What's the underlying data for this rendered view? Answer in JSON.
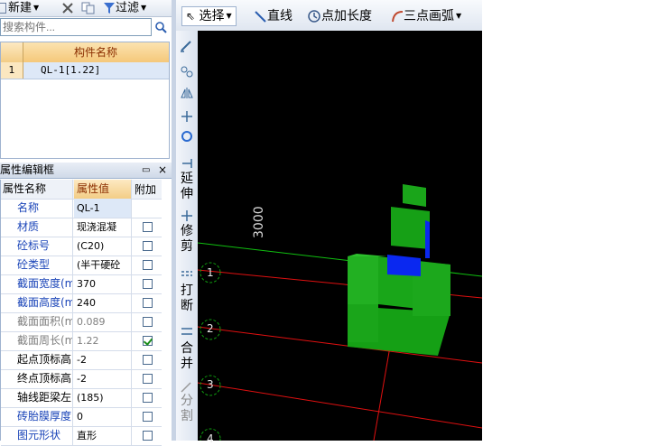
{
  "left_toolbar": {
    "new_label": "新建",
    "filter_label": "过滤"
  },
  "search": {
    "placeholder": "搜索构件..."
  },
  "component_table": {
    "header": "构件名称",
    "rows": [
      {
        "index": "1",
        "name": "QL-1[1.22]"
      }
    ]
  },
  "property_panel": {
    "title": "属性编辑框",
    "pin_label": "ㅁ",
    "close_label": "×",
    "columns": [
      "属性名称",
      "属性值",
      "附加"
    ],
    "rows": [
      {
        "name": "名称",
        "value": "QL-1",
        "checkbox": false,
        "style": "blue"
      },
      {
        "name": "材质",
        "value": "现浇混凝",
        "checkbox": true,
        "checked": false,
        "style": "blue"
      },
      {
        "name": "砼标号",
        "value": "(C20)",
        "checkbox": true,
        "checked": false,
        "style": "blue"
      },
      {
        "name": "砼类型",
        "value": "(半干硬砼",
        "checkbox": true,
        "checked": false,
        "style": "blue"
      },
      {
        "name": "截面宽度(m",
        "value": "370",
        "checkbox": true,
        "checked": false,
        "style": "blue"
      },
      {
        "name": "截面高度(m",
        "value": "240",
        "checkbox": true,
        "checked": false,
        "style": "blue"
      },
      {
        "name": "截面面积(m",
        "value": "0.089",
        "checkbox": true,
        "checked": false,
        "style": "gray"
      },
      {
        "name": "截面周长(m",
        "value": "1.22",
        "checkbox": true,
        "checked": true,
        "style": "gray"
      },
      {
        "name": "起点顶标高",
        "value": "-2",
        "checkbox": true,
        "checked": false,
        "style": "black"
      },
      {
        "name": "终点顶标高",
        "value": "-2",
        "checkbox": true,
        "checked": false,
        "style": "black"
      },
      {
        "name": "轴线距梁左",
        "value": "(185)",
        "checkbox": true,
        "checked": false,
        "style": "black"
      },
      {
        "name": "砖胎膜厚度",
        "value": "0",
        "checkbox": true,
        "checked": false,
        "style": "blue"
      },
      {
        "name": "图元形状",
        "value": "直形",
        "checkbox": true,
        "checked": false,
        "style": "blue"
      }
    ]
  },
  "vertical_toolbar": {
    "extend": "延伸",
    "trim": "修剪",
    "break": "打断",
    "merge": "合并",
    "split": "分割"
  },
  "drawing_toolbar": {
    "select_label": "选择",
    "line_label": "直线",
    "point_length_label": "点加长度",
    "three_point_arc_label": "三点画弧"
  },
  "canvas": {
    "dimension_text": "3000",
    "axis_labels": [
      "1",
      "2",
      "3",
      "4"
    ],
    "colors": {
      "background": "#000000",
      "axis_red": "#e01010",
      "axis_green": "#10c010",
      "solid_green": "#10a010",
      "highlight_blue": "#0a28f0"
    }
  }
}
